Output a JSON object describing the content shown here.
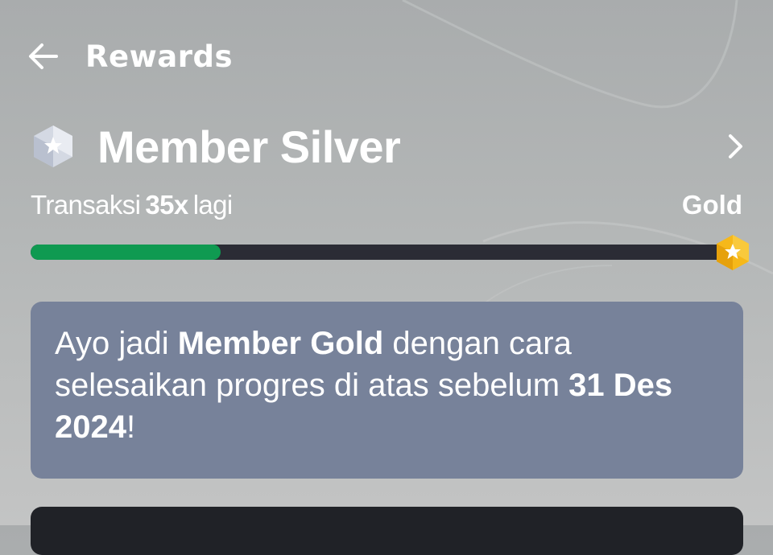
{
  "header": {
    "title": "Rewards",
    "back_icon": "arrow-left-icon"
  },
  "tier": {
    "name": "Member Silver",
    "badge_icon": "silver-hexagon-star-icon",
    "chevron_icon": "chevron-right-icon"
  },
  "progress": {
    "prefix": "Transaksi",
    "count": "35x",
    "suffix": "lagi",
    "target": "Gold",
    "fill_fraction": 0.27,
    "fill_color": "#0f9a51",
    "track_color": "#2b2c35",
    "target_badge_icon": "gold-hexagon-star-icon"
  },
  "info_card": {
    "part1": "Ayo jadi ",
    "highlight1": "Member Gold",
    "part2": " dengan cara selesaikan progres di atas sebelum ",
    "highlight2": "31 Des 2024",
    "part3": "!",
    "background_color": "#77829a"
  }
}
